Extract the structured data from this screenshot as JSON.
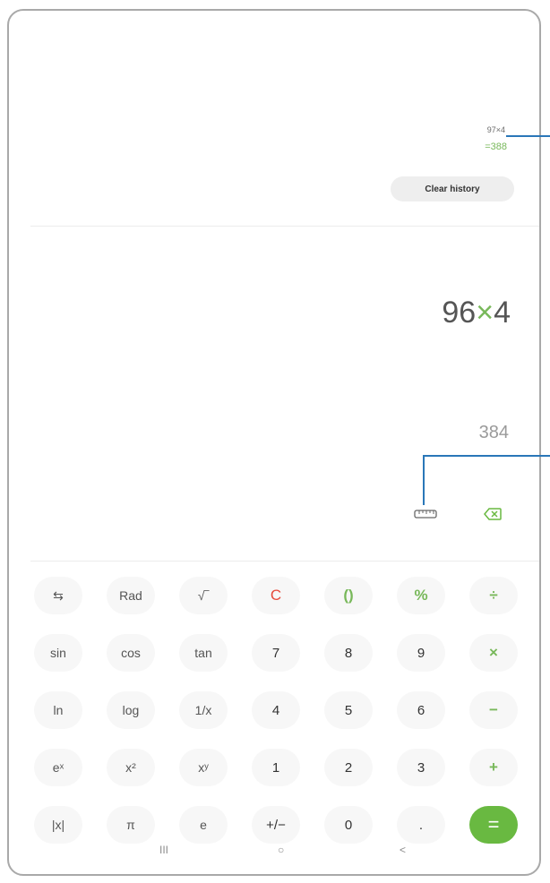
{
  "history": {
    "expression": "97×4",
    "result": "=388",
    "clear_label": "Clear history"
  },
  "display": {
    "expr_left": "96",
    "expr_op": "×",
    "expr_right": "4",
    "preview": "384"
  },
  "icons": {
    "ruler": "ruler-icon",
    "backspace": "backspace-icon"
  },
  "keypad": {
    "rows": [
      [
        "⇆",
        "Rad",
        "√‾",
        "C",
        "()",
        "%",
        "÷"
      ],
      [
        "sin",
        "cos",
        "tan",
        "7",
        "8",
        "9",
        "×"
      ],
      [
        "ln",
        "log",
        "1/x",
        "4",
        "5",
        "6",
        "−"
      ],
      [
        "eˣ",
        "x²",
        "xʸ",
        "1",
        "2",
        "3",
        "+"
      ],
      [
        "|x|",
        "π",
        "e",
        "+/−",
        "0",
        ".",
        "="
      ]
    ]
  },
  "nav": {
    "recent": "III",
    "home": "○",
    "back": "<"
  },
  "colors": {
    "accent": "#69b941",
    "clear": "#e64b3c",
    "callout": "#2a77b8"
  }
}
